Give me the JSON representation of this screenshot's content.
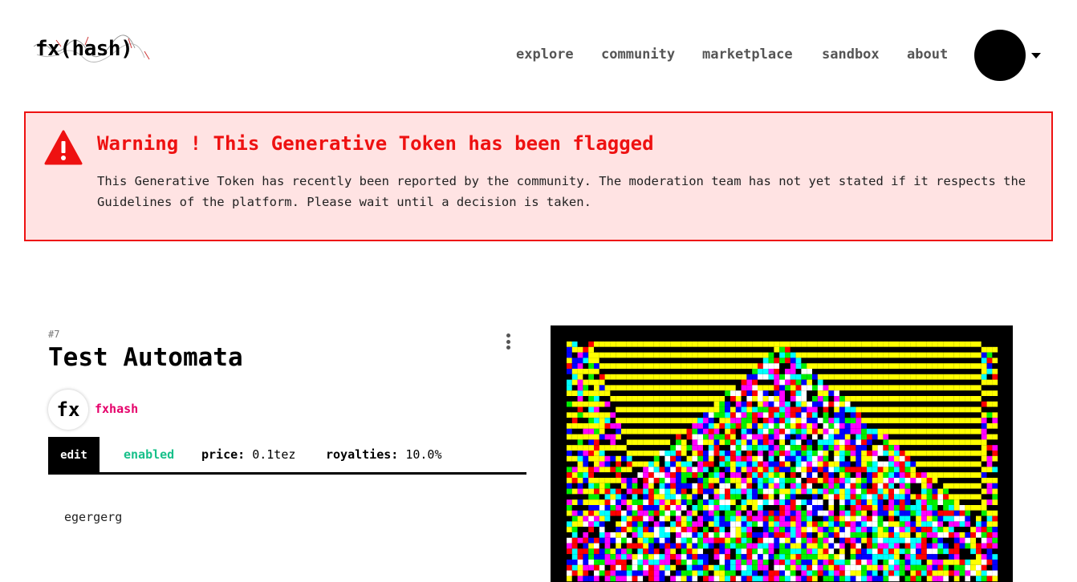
{
  "header": {
    "logo_text": "fx(hash)",
    "nav": [
      {
        "label": "explore"
      },
      {
        "label": "community"
      },
      {
        "label": "marketplace"
      },
      {
        "label": "sandbox"
      },
      {
        "label": "about"
      }
    ]
  },
  "warning": {
    "icon": "warning-triangle-icon",
    "title": "Warning ! This Generative Token has been flagged",
    "text": "This Generative Token has recently been reported by the community. The moderation team has not yet stated if it respects the Guidelines of the platform. Please wait until a decision is taken."
  },
  "token": {
    "id": "#7",
    "title": "Test Automata",
    "author": {
      "avatar_text": "fx",
      "name": "fxhash"
    },
    "edit_label": "edit",
    "status": "enabled",
    "price_label": "price:",
    "price_value": "0.1tez",
    "royalties_label": "royalties:",
    "royalties_value": "10.0%",
    "description": "egergerg"
  },
  "colors": {
    "warning_red": "#ee1111",
    "warning_bg": "#ffe3e3",
    "author_pink": "#e5006a",
    "enabled_green": "#17c08a"
  }
}
